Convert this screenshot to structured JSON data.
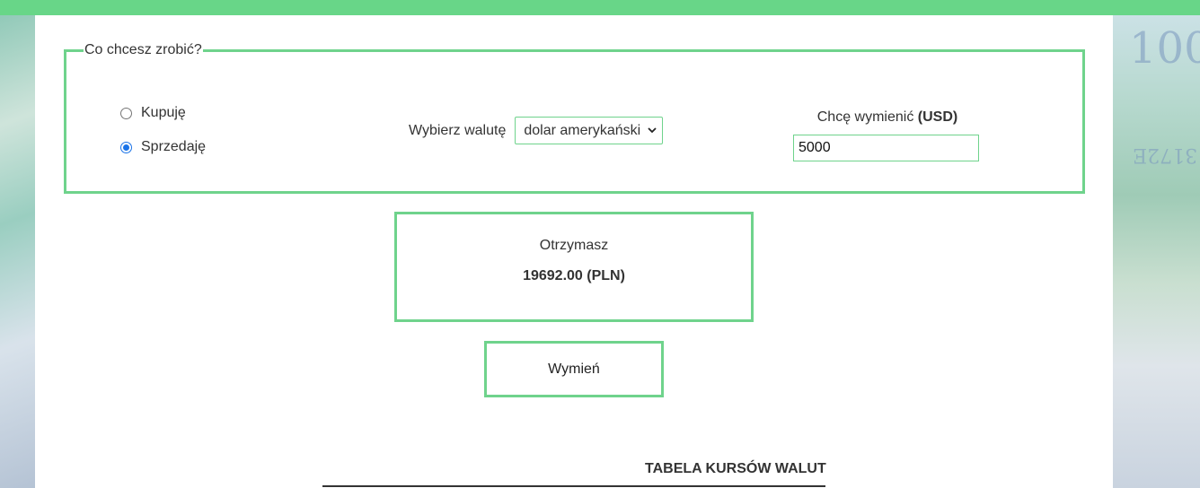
{
  "colors": {
    "accent_green": "#6fd38c",
    "topbar_green": "#68d688",
    "radio_blue": "#1a73e8"
  },
  "form": {
    "legend": "Co chcesz zrobić?",
    "radio_buy_label": "Kupuję",
    "radio_sell_label": "Sprzedaję",
    "selected_action": "Sprzedaję",
    "currency_label": "Wybierz walutę",
    "currency_selected": "dolar amerykański",
    "amount_label": "Chcę wymienić",
    "amount_currency": "(USD)",
    "amount_value": "5000"
  },
  "result": {
    "label": "Otrzymasz",
    "value": "19692.00 (PLN)"
  },
  "exchange_button_label": "Wymień",
  "table": {
    "title": "TABELA KURSÓW WALUT"
  },
  "background": {
    "bill_text_1": "100",
    "bill_text_2": "3172E"
  }
}
